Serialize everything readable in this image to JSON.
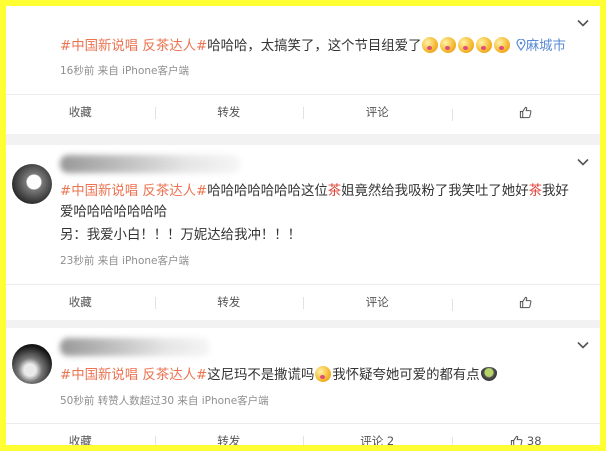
{
  "actions": {
    "save": "收藏",
    "repost": "转发",
    "comment": "评论"
  },
  "posts": [
    {
      "tag": "#中国新说唱 反茶达人#",
      "text": "哈哈哈，太搞笑了，这个节目组爱了",
      "location": "麻城市",
      "meta": "16秒前  来自 iPhone客户端",
      "comment_count": "",
      "like_count": ""
    },
    {
      "tag": "#中国新说唱 反茶达人#",
      "text_a": "哈哈哈哈哈哈哈这位",
      "red1": "茶",
      "text_b": "姐竟然给我吸粉了我笑吐了她好",
      "red2": "茶",
      "text_c": "我好爱哈哈哈哈哈哈哈",
      "line2": "另：我爱小白！！！万妮达给我冲！！！",
      "meta": "23秒前  来自 iPhone客户端",
      "comment_count": "",
      "like_count": ""
    },
    {
      "tag": "#中国新说唱 反茶达人#",
      "text_a": "这尼玛不是撒谎吗",
      "text_b": "我怀疑夸她可爱的都有点",
      "meta": "50秒前  转赞人数超过30  来自 iPhone客户端",
      "comment_count": "2",
      "like_count": "38"
    }
  ],
  "icons": [
    "chevron-down-icon",
    "thumbs-up-icon",
    "location-pin-icon",
    "emoji-icon",
    "bowl-emoji-icon"
  ]
}
